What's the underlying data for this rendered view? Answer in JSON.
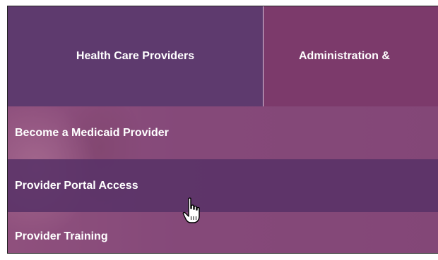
{
  "nav": {
    "tabs": [
      {
        "label": "Health Care Providers"
      },
      {
        "label": "Administration &"
      }
    ]
  },
  "dropdown": {
    "items": [
      {
        "label": "Become a Medicaid Provider"
      },
      {
        "label": "Provider Portal Access"
      },
      {
        "label": "Provider Training"
      }
    ]
  },
  "cursor": {
    "icon": "hand-pointer-icon"
  },
  "colors": {
    "active_tab": "#5e3a6e",
    "next_tab": "#7c3a6b",
    "hover_item": "#5c3468"
  }
}
